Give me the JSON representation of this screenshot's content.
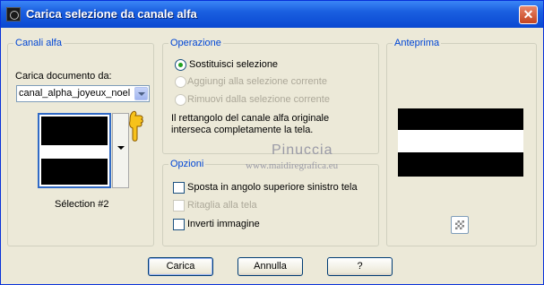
{
  "window": {
    "title": "Carica selezione da canale alfa",
    "close_label": "✕"
  },
  "canali": {
    "group_label": "Canali alfa",
    "doc_label": "Carica documento da:",
    "doc_value": "canal_alpha_joyeux_noel",
    "selection_name": "Sélection #2"
  },
  "operazione": {
    "group_label": "Operazione",
    "options": [
      {
        "label": "Sostituisci selezione",
        "selected": true,
        "enabled": true
      },
      {
        "label": "Aggiungi alla selezione corrente",
        "selected": false,
        "enabled": false
      },
      {
        "label": "Rimuovi dalla selezione corrente",
        "selected": false,
        "enabled": false
      }
    ],
    "info_line1": "Il rettangolo del canale alfa originale",
    "info_line2": "interseca completamente la tela."
  },
  "opzioni": {
    "group_label": "Opzioni",
    "checks": [
      {
        "label": "Sposta in angolo superiore sinistro tela",
        "checked": false,
        "enabled": true
      },
      {
        "label": "Ritaglia alla tela",
        "checked": false,
        "enabled": false
      },
      {
        "label": "Inverti immagine",
        "checked": false,
        "enabled": true
      }
    ]
  },
  "anteprima": {
    "group_label": "Anteprima"
  },
  "watermark": {
    "name": "Pinuccia",
    "site": "www.maidiregrafica.eu"
  },
  "buttons": {
    "ok": "Carica",
    "cancel": "Annulla",
    "help": "?"
  },
  "icons": {
    "app": "app-icon",
    "close": "close-icon",
    "dropdown": "chevron-down-icon",
    "hand": "pointing-hand-icon",
    "preview_toggle": "checkerboard-icon"
  }
}
